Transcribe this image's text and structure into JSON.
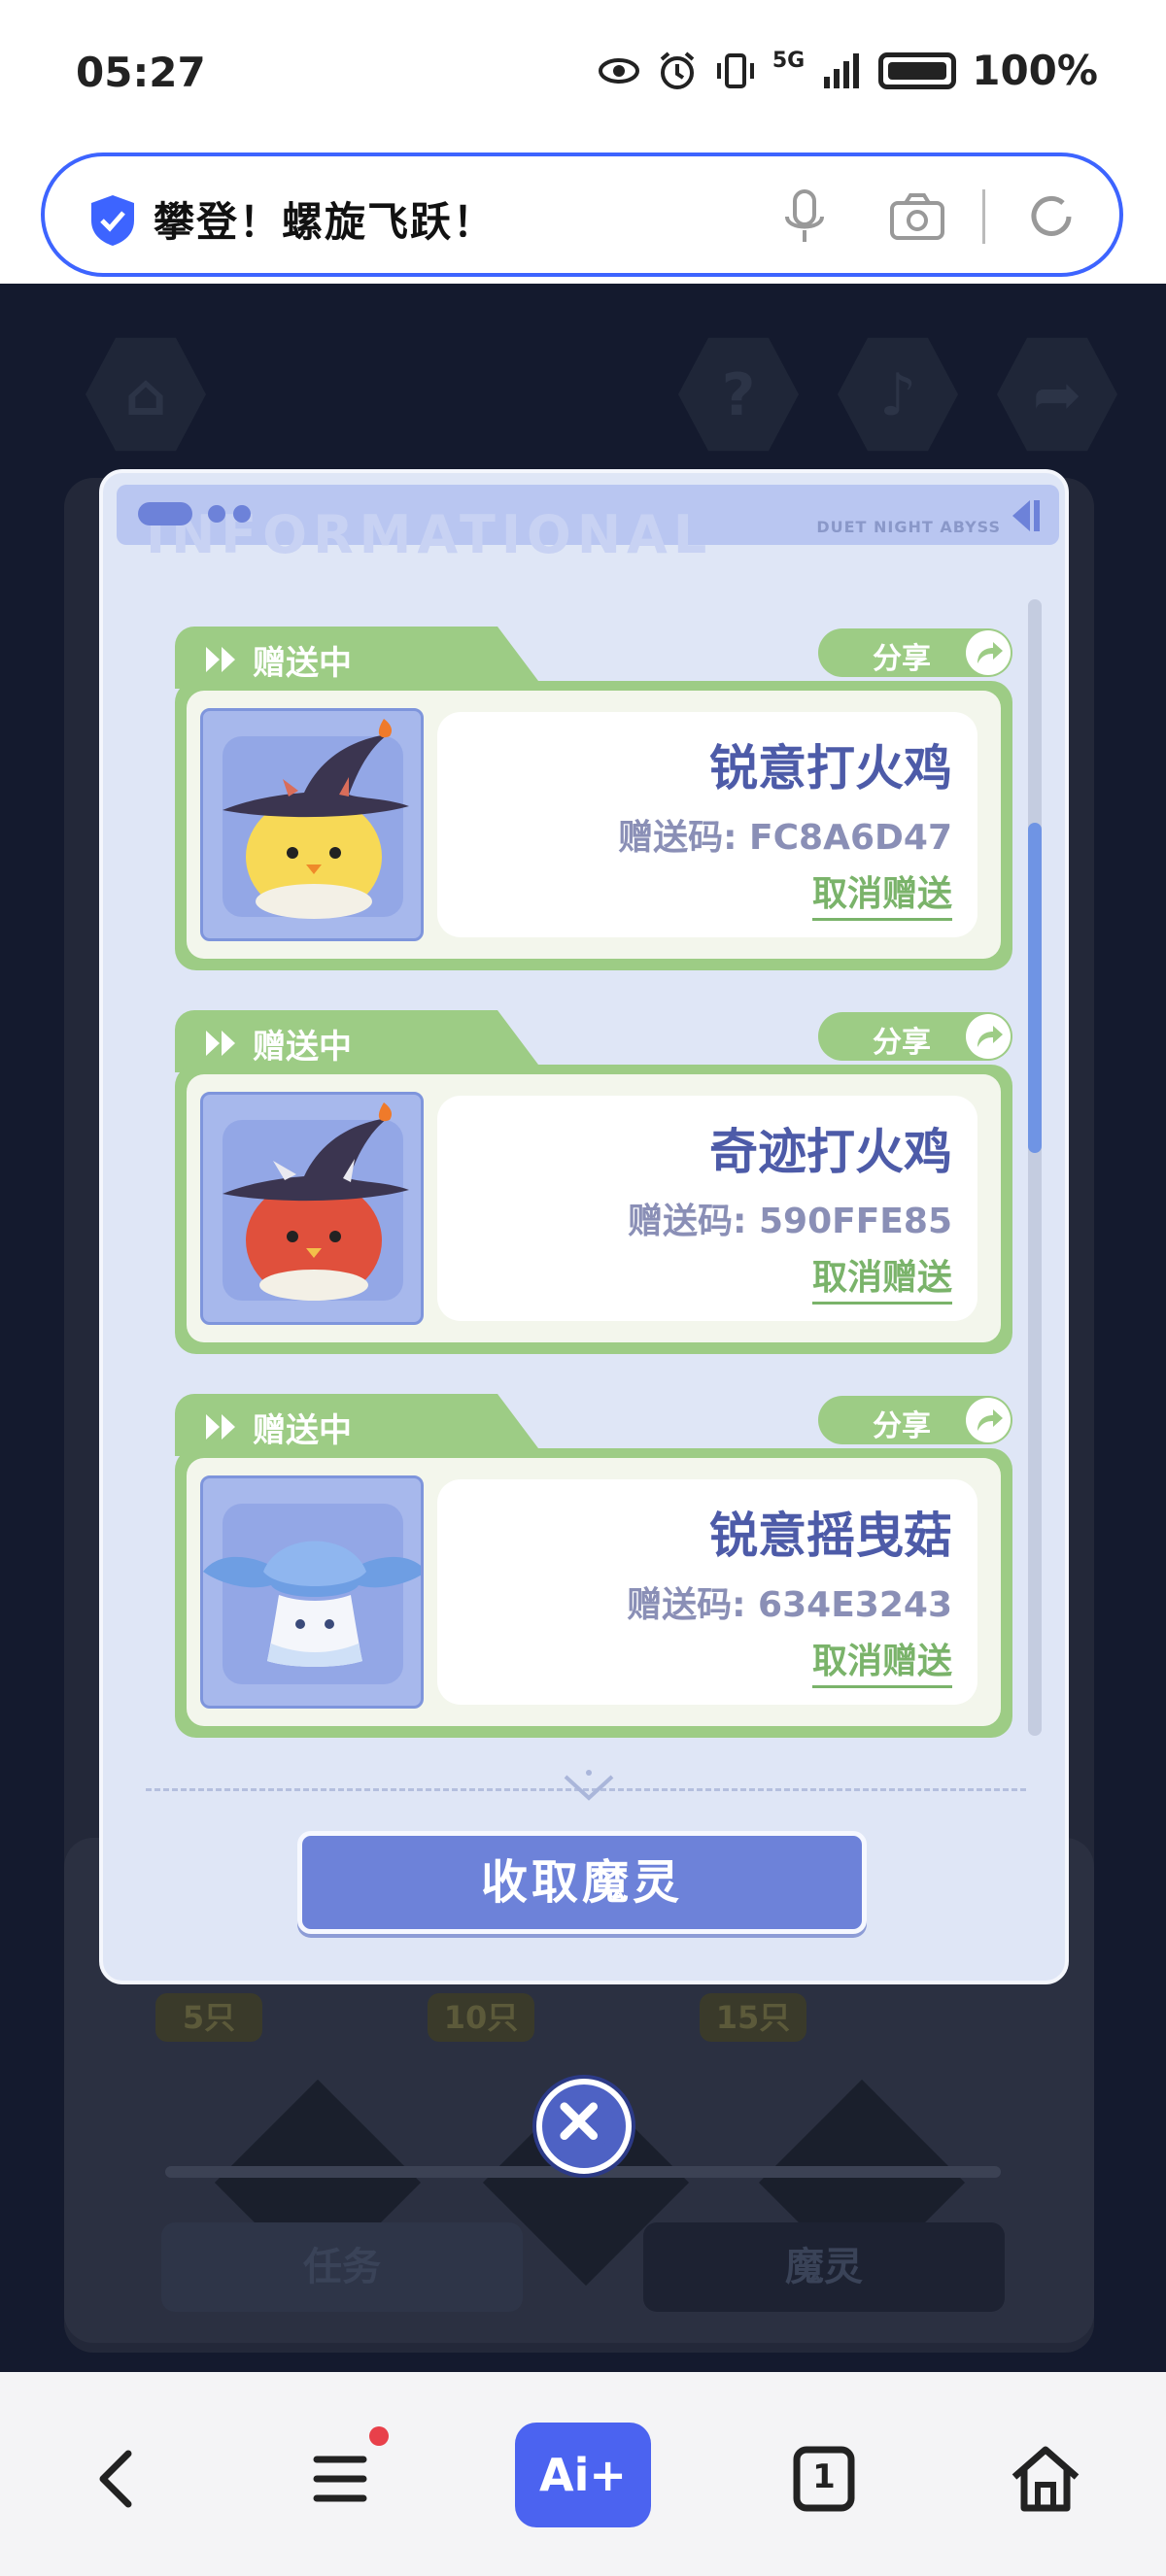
{
  "status_bar": {
    "time": "05:27",
    "network": "5G",
    "battery": "100%"
  },
  "address_bar": {
    "title": "攀登！螺旋飞跃！"
  },
  "game": {
    "top_buttons": [
      "home-icon",
      "help-icon",
      "music-icon",
      "share-icon"
    ],
    "milestones": [
      "5只",
      "10只",
      "15只"
    ],
    "bottom_buttons": {
      "tasks": "任务",
      "spirits": "魔灵"
    }
  },
  "modal": {
    "header_brand": "DUET NIGHT ABYSS",
    "header_ghost_text": "INFORMATIONAL",
    "cards": [
      {
        "status": "赠送中",
        "share": "分享",
        "name": "锐意打火鸡",
        "code": "赠送码: FC8A6D47",
        "cancel": "取消赠送",
        "creature": "yellow-chick-witch-hat"
      },
      {
        "status": "赠送中",
        "share": "分享",
        "name": "奇迹打火鸡",
        "code": "赠送码: 590FFE85",
        "cancel": "取消赠送",
        "creature": "red-chick-witch-hat"
      },
      {
        "status": "赠送中",
        "share": "分享",
        "name": "锐意摇曳菇",
        "code": "赠送码: 634E3243",
        "cancel": "取消赠送",
        "creature": "blue-mushroom"
      }
    ],
    "collect_button": "收取魔灵"
  },
  "bottom_nav": {
    "ai_label": "Ai+",
    "tab_count": "1"
  }
}
